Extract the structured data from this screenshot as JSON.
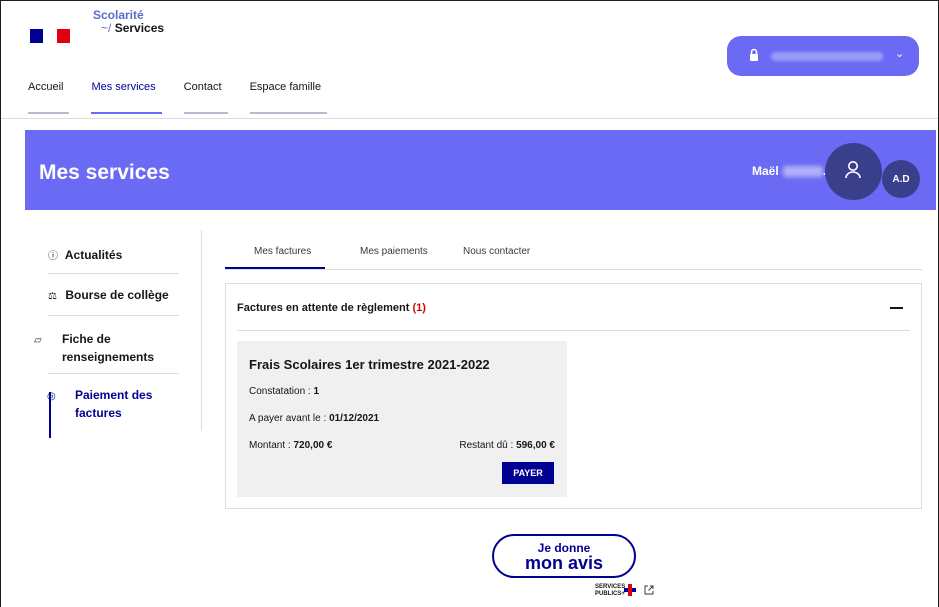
{
  "header": {
    "logo": {
      "line1": "Scolarité",
      "line2": "Services"
    },
    "nav": [
      {
        "label": "Accueil"
      },
      {
        "label": "Mes services"
      },
      {
        "label": "Contact"
      },
      {
        "label": "Espace famille"
      }
    ],
    "user_menu": {
      "icon": "lock-icon",
      "chevron": "⌄"
    }
  },
  "banner": {
    "title": "Mes services",
    "student_name": "Maël",
    "student_suffix": ".",
    "avatar_initials": "A.D"
  },
  "sidebar": {
    "items": [
      {
        "icon": "ⓘ",
        "label": "Actualités"
      },
      {
        "icon": "⚖",
        "label": "Bourse de collège"
      },
      {
        "icon": "▱",
        "label": "Fiche de renseignements"
      },
      {
        "icon": "◎",
        "label": "Paiement des factures"
      }
    ]
  },
  "tabs": [
    {
      "label": "Mes factures"
    },
    {
      "label": "Mes paiements"
    },
    {
      "label": "Nous contacter"
    }
  ],
  "panel": {
    "title": "Factures en attente de règlement",
    "count": "(1)",
    "collapse": "—"
  },
  "invoice": {
    "title": "Frais Scolaires 1er trimestre 2021-2022",
    "constatation_label": "Constatation :",
    "constatation_value": "1",
    "due_label": "A payer avant le :",
    "due_value": "01/12/2021",
    "amount_label": "Montant :",
    "amount_value": "720,00 €",
    "remaining_label": "Restant dû :",
    "remaining_value": "596,00 €",
    "pay_button": "PAYER"
  },
  "feedback": {
    "line1": "Je donne",
    "line2": "mon avis",
    "sp_line1": "SERVICES",
    "sp_line2": "PUBLICS+"
  },
  "colors": {
    "primary": "#000091",
    "accent": "#6a6af4",
    "alert": "#ce0500"
  }
}
